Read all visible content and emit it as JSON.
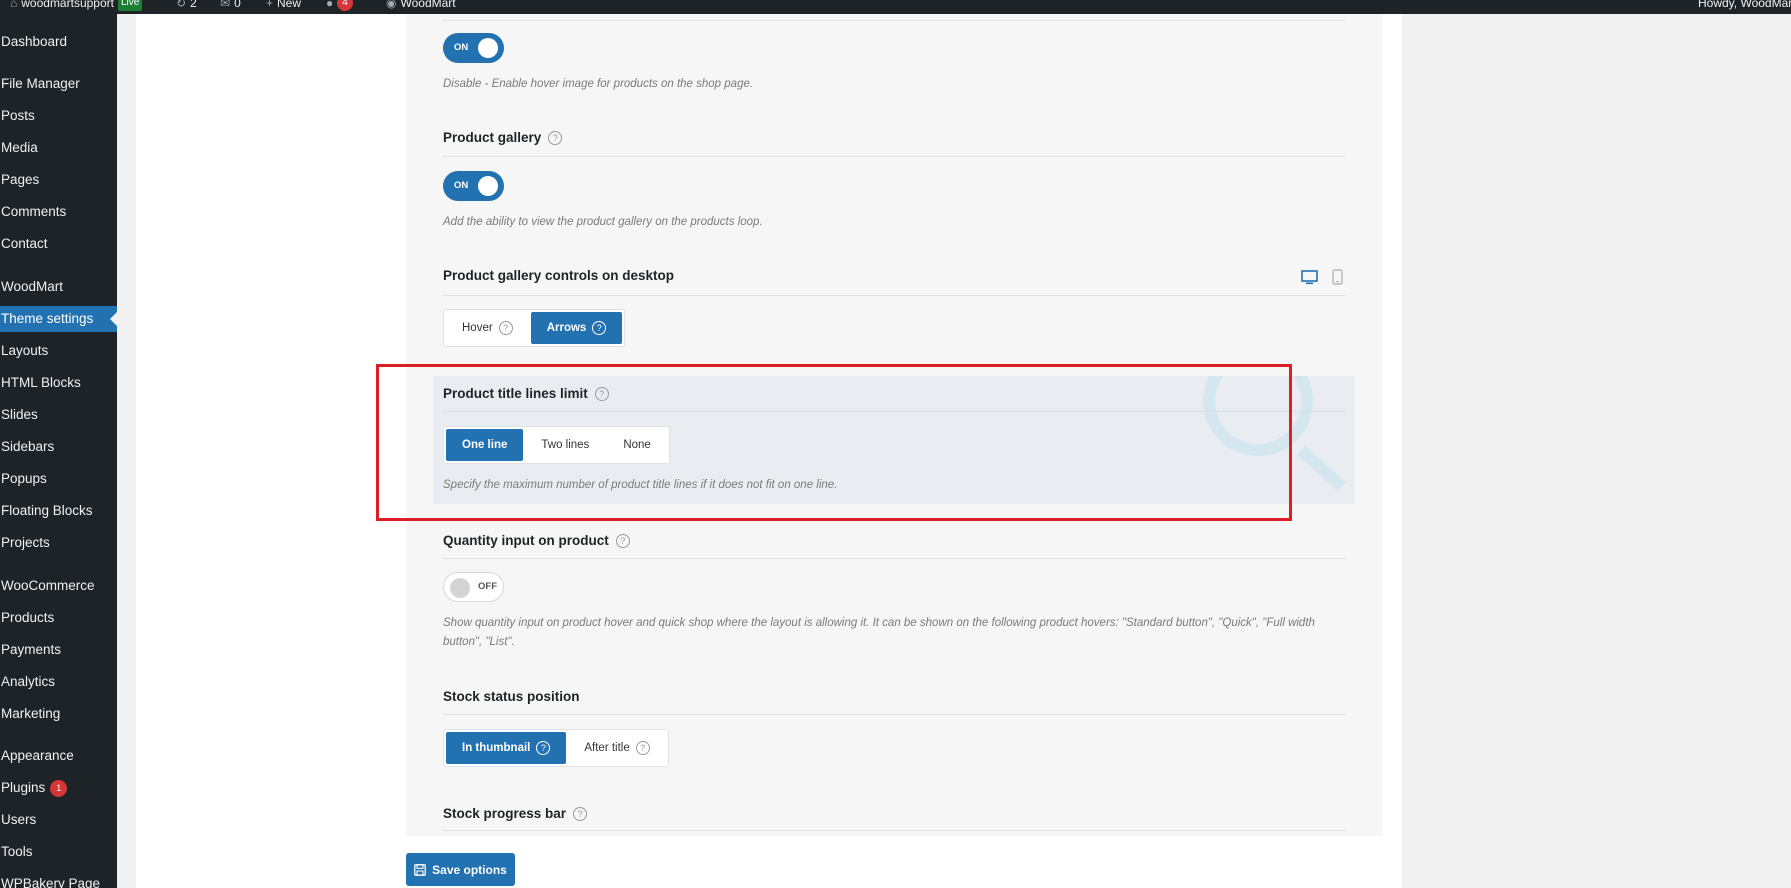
{
  "admin_bar": {
    "site_name": "woodmartsupport",
    "live_label": "Live",
    "updates_count": "2",
    "comments_count": "0",
    "new_label": "New",
    "notifications_count": "4",
    "theme_label": "WoodMart",
    "greeting": "Howdy, WoodMart"
  },
  "sidebar": {
    "items": [
      {
        "label": "Dashboard"
      },
      {
        "label": "File Manager"
      },
      {
        "label": "Posts"
      },
      {
        "label": "Media"
      },
      {
        "label": "Pages"
      },
      {
        "label": "Comments"
      },
      {
        "label": "Contact"
      },
      {
        "label": "WoodMart"
      },
      {
        "label": "Theme settings"
      },
      {
        "label": "Layouts"
      },
      {
        "label": "HTML Blocks"
      },
      {
        "label": "Slides"
      },
      {
        "label": "Sidebars"
      },
      {
        "label": "Popups"
      },
      {
        "label": "Floating Blocks"
      },
      {
        "label": "Projects"
      },
      {
        "label": "WooCommerce"
      },
      {
        "label": "Products"
      },
      {
        "label": "Payments"
      },
      {
        "label": "Analytics"
      },
      {
        "label": "Marketing"
      },
      {
        "label": "Appearance"
      },
      {
        "label": "Plugins",
        "badge": "1"
      },
      {
        "label": "Users"
      },
      {
        "label": "Tools"
      },
      {
        "label": "WPBakery Page"
      }
    ]
  },
  "settings": {
    "hover_image": {
      "toggle": "ON",
      "description": "Disable - Enable hover image for products on the shop page."
    },
    "product_gallery": {
      "title": "Product gallery",
      "toggle": "ON",
      "description": "Add the ability to view the product gallery on the products loop."
    },
    "gallery_controls": {
      "title": "Product gallery controls on desktop",
      "options": [
        "Hover",
        "Arrows"
      ],
      "selected": "Arrows"
    },
    "title_lines_limit": {
      "title": "Product title lines limit",
      "options": [
        "One line",
        "Two lines",
        "None"
      ],
      "selected": "One line",
      "description": "Specify the maximum number of product title lines if it does not fit on one line."
    },
    "quantity_input": {
      "title": "Quantity input on product",
      "toggle": "OFF",
      "description": "Show quantity input on product hover and quick shop where the layout is allowing it. It can be shown on the following product hovers: \"Standard button\", \"Quick\", \"Full width button\", \"List\"."
    },
    "stock_status": {
      "title": "Stock status position",
      "options": [
        "In thumbnail",
        "After title"
      ],
      "selected": "In thumbnail"
    },
    "stock_progress": {
      "title": "Stock progress bar"
    }
  },
  "footer": {
    "save_label": "Save options"
  },
  "colors": {
    "accent": "#2271b1",
    "highlight_border": "#dc1f26",
    "sidebar_bg": "#1d2327"
  }
}
